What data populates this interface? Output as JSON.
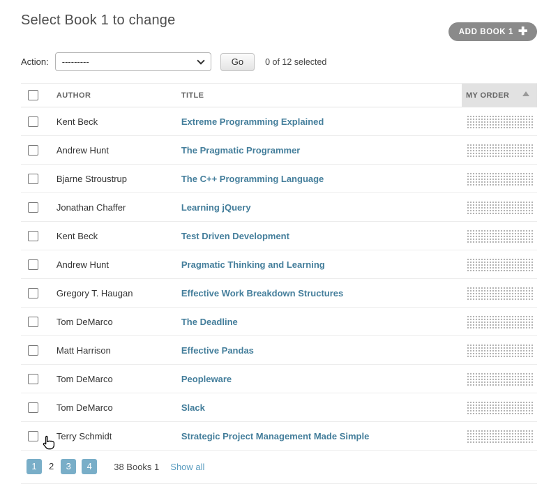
{
  "page": {
    "title": "Select Book 1 to change",
    "add_button_label": "ADD BOOK 1",
    "add_button_icon": "plus"
  },
  "actions": {
    "label": "Action:",
    "select_value": "---------",
    "go_label": "Go",
    "counter": "0 of 12 selected"
  },
  "table": {
    "headers": {
      "author": "AUTHOR",
      "title": "TITLE",
      "order": "MY ORDER"
    },
    "sort_icon": "triangle-up",
    "rows": [
      {
        "author": "Kent Beck",
        "title": "Extreme Programming Explained"
      },
      {
        "author": "Andrew Hunt",
        "title": "The Pragmatic Programmer"
      },
      {
        "author": "Bjarne Stroustrup",
        "title": "The C++ Programming Language"
      },
      {
        "author": "Jonathan Chaffer",
        "title": "Learning jQuery"
      },
      {
        "author": "Kent Beck",
        "title": "Test Driven Development"
      },
      {
        "author": "Andrew Hunt",
        "title": "Pragmatic Thinking and Learning"
      },
      {
        "author": "Gregory T. Haugan",
        "title": "Effective Work Breakdown Structures"
      },
      {
        "author": "Tom DeMarco",
        "title": "The Deadline"
      },
      {
        "author": "Matt Harrison",
        "title": "Effective Pandas"
      },
      {
        "author": "Tom DeMarco",
        "title": "Peopleware"
      },
      {
        "author": "Tom DeMarco",
        "title": "Slack"
      },
      {
        "author": "Terry Schmidt",
        "title": "Strategic Project Management Made Simple"
      }
    ]
  },
  "pagination": {
    "pages": [
      {
        "label": "1",
        "current": false
      },
      {
        "label": "2",
        "current": true
      },
      {
        "label": "3",
        "current": false
      },
      {
        "label": "4",
        "current": false
      }
    ],
    "summary": "38 Books 1",
    "show_all_label": "Show all"
  },
  "colors": {
    "accent_blue": "#79aec8",
    "link_teal": "#447e9b",
    "button_gray": "#8a8a8a",
    "sorted_header_bg": "#e2e2e2"
  }
}
